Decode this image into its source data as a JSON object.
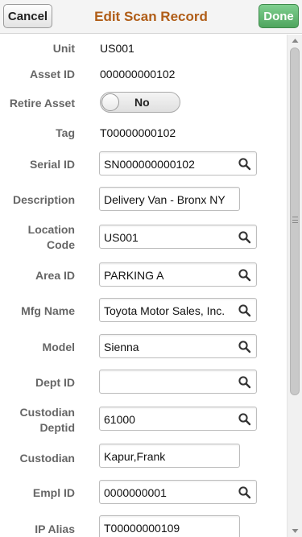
{
  "header": {
    "title": "Edit Scan Record",
    "cancel_label": "Cancel",
    "done_label": "Done"
  },
  "form": {
    "unit": {
      "label": "Unit",
      "value": "US001"
    },
    "asset_id": {
      "label": "Asset ID",
      "value": "000000000102"
    },
    "retire_asset": {
      "label": "Retire Asset",
      "value": "No"
    },
    "tag": {
      "label": "Tag",
      "value": "T00000000102"
    },
    "serial_id": {
      "label": "Serial ID",
      "value": "SN000000000102"
    },
    "description": {
      "label": "Description",
      "value": "Delivery Van - Bronx NY"
    },
    "location_code": {
      "label_line1": "Location",
      "label_line2": "Code",
      "value": "US001"
    },
    "area_id": {
      "label": "Area ID",
      "value": "PARKING A"
    },
    "mfg_name": {
      "label": "Mfg Name",
      "value": "Toyota Motor Sales, Inc."
    },
    "model": {
      "label": "Model",
      "value": "Sienna"
    },
    "dept_id": {
      "label": "Dept ID",
      "value": ""
    },
    "custodian_deptid": {
      "label_line1": "Custodian",
      "label_line2": "Deptid",
      "value": "61000"
    },
    "custodian": {
      "label": "Custodian",
      "value": "Kapur,Frank"
    },
    "empl_id": {
      "label": "Empl ID",
      "value": "0000000001"
    },
    "ip_alias": {
      "label": "IP Alias",
      "value": "T00000000109"
    }
  },
  "colors": {
    "title": "#b05d17",
    "label": "#666666",
    "done_button": "#5cb46b"
  }
}
